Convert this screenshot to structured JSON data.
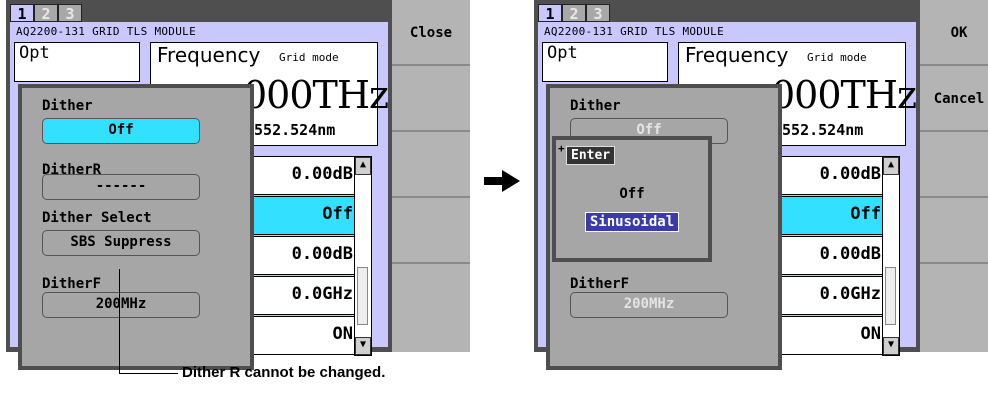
{
  "left_screen": {
    "tabs": [
      "1",
      "2",
      "3"
    ],
    "module_title": "AQ2200-131 GRID TLS MODULE",
    "opt_label": "Opt",
    "freq_label": "Frequency",
    "freq_mode": "Grid mode",
    "freq_value": "000THz",
    "wavelength": "1552.524nm",
    "rows": [
      "0.00dB",
      "Off",
      "0.00dB",
      "0.0GHz",
      "ON"
    ],
    "softkeys": [
      "Close",
      "",
      "",
      "",
      ""
    ],
    "dither": {
      "dither_label": "Dither",
      "dither_value": "Off",
      "ditherr_label": "DitherR",
      "ditherr_value": "------",
      "select_label": "Dither Select",
      "select_value": "SBS Suppress",
      "ditherf_label": "DitherF",
      "ditherf_value": "200MHz"
    }
  },
  "right_screen": {
    "tabs": [
      "1",
      "2",
      "3"
    ],
    "module_title": "AQ2200-131 GRID TLS MODULE",
    "opt_label": "Opt",
    "freq_label": "Frequency",
    "freq_mode": "Grid mode",
    "freq_value": "000THz",
    "wavelength": "1552.524nm",
    "rows": [
      "0.00dB",
      "Off",
      "0.00dB",
      "0.0GHz",
      "ON"
    ],
    "softkeys": [
      "OK",
      "Cancel",
      "",
      "",
      ""
    ],
    "dither": {
      "dither_label": "Dither",
      "dither_value": "Off",
      "ditherf_label": "DitherF",
      "ditherf_value": "200MHz"
    },
    "enter_popup": {
      "plus": "+",
      "title": "Enter",
      "options": [
        "Off",
        "Sinusoidal"
      ],
      "selected": "Sinusoidal"
    }
  },
  "callout_text": "Dither R cannot be changed.",
  "colors": {
    "highlight": "#33e0ff",
    "panel": "#c8c8ff",
    "select_blue": "#3a3aaa"
  }
}
